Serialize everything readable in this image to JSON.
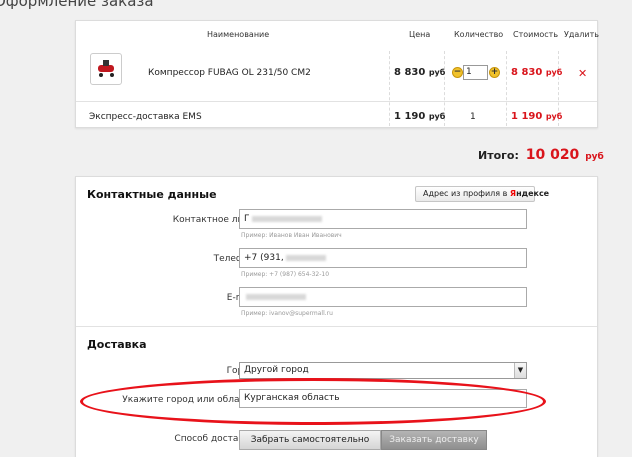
{
  "page_title": "Оформление заказа",
  "order_table": {
    "headers": {
      "name": "Наименование",
      "price": "Цена",
      "qty": "Количество",
      "cost": "Стоимость",
      "delete": "Удалить"
    },
    "items": [
      {
        "name": "Компрессор FUBAG OL 231/50 CM2",
        "price": "8 830",
        "currency": "руб",
        "qty": "1",
        "cost": "8 830",
        "delete_icon": "✕"
      }
    ],
    "shipping": {
      "name": "Экспресс-доставка EMS",
      "price": "1 190",
      "currency": "руб",
      "qty": "1",
      "cost": "1 190"
    },
    "qty_minus": "−",
    "qty_plus": "+"
  },
  "total": {
    "label": "Итого:",
    "value": "10 020",
    "currency": "руб"
  },
  "contact": {
    "title": "Контактные данные",
    "yandex_button": {
      "prefix": "Адрес из профиля в ",
      "brand_first": "Я",
      "brand_rest": "ндексе"
    },
    "fields": [
      {
        "label": "Контактное лицо",
        "value": "Г",
        "hint": "Пример: Иванов Иван Иванович"
      },
      {
        "label": "Телефон",
        "value": "+7 (931,",
        "hint": "Пример: +7 (987) 654-32-10"
      },
      {
        "label": "E-mail",
        "value": "",
        "hint": "Пример: ivanov@supermall.ru"
      }
    ]
  },
  "delivery": {
    "title": "Доставка",
    "city_label": "Город",
    "city_value": "Другой город",
    "region_label": "Укажите город или область",
    "region_value": "Курганская область",
    "method_label": "Способ доставки",
    "pickup_button": "Забрать самостоятельно",
    "order_button": "Заказать доставку"
  },
  "colors": {
    "accent_red": "#d9141b",
    "annotation_red": "#e8121a",
    "qty_button_yellow": "#f1c22b"
  }
}
